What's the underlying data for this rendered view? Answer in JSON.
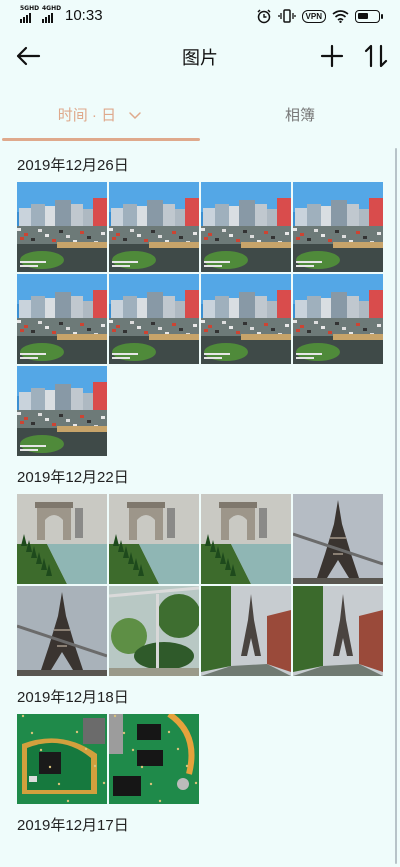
{
  "status_bar": {
    "sim1": "5GHD",
    "sim2": "4GHD",
    "time": "10:33",
    "vpn": "VPN",
    "battery_level": 0.55
  },
  "header": {
    "title": "图片"
  },
  "tabs": [
    {
      "label": "时间 · 日",
      "active": true
    },
    {
      "label": "相簿",
      "active": false
    }
  ],
  "groups": [
    {
      "date": "2019年12月26日",
      "photo_count": 9,
      "kind": "city"
    },
    {
      "date": "2019年12月22日",
      "photo_count": 8,
      "kind": "paris",
      "scenes": [
        "arch",
        "arch",
        "arch",
        "tower",
        "tower",
        "garden",
        "tower-street",
        "tower-street"
      ]
    },
    {
      "date": "2019年12月18日",
      "photo_count": 2,
      "kind": "pcb"
    },
    {
      "date": "2019年12月17日",
      "photo_count": 0,
      "kind": "none"
    }
  ],
  "colors": {
    "background": "#effcfb",
    "accent": "#dfa98c",
    "inactive_tab": "#777777"
  }
}
